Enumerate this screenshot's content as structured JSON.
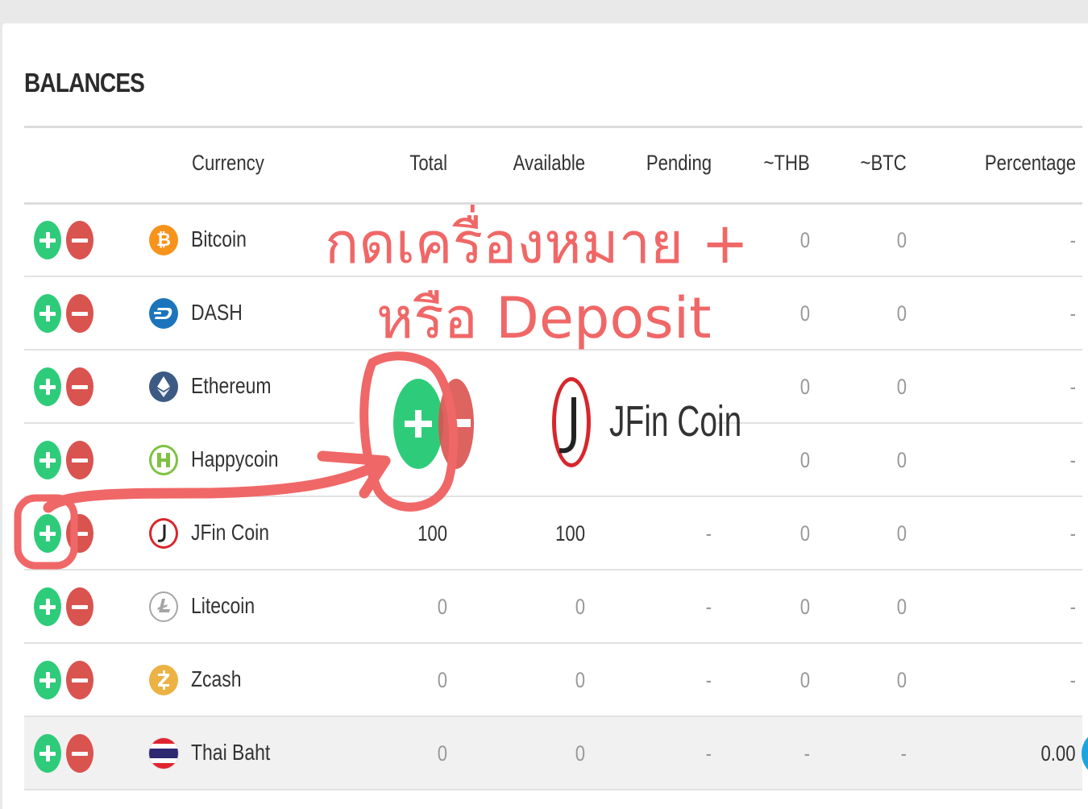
{
  "title": "BALANCES",
  "columns": {
    "currency": "Currency",
    "total": "Total",
    "available": "Available",
    "pending": "Pending",
    "thb": "~THB",
    "btc": "~BTC",
    "percentage": "Percentage"
  },
  "rows": [
    {
      "name": "Bitcoin",
      "icon": "bitcoin-icon",
      "icon_color": "#f7931a",
      "total": "",
      "available": "",
      "pending": "",
      "thb": "0",
      "btc": "0",
      "percentage": "-"
    },
    {
      "name": "DASH",
      "icon": "dash-icon",
      "icon_color": "#1c75bc",
      "total": "",
      "available": "",
      "pending": "",
      "thb": "0",
      "btc": "0",
      "percentage": "-"
    },
    {
      "name": "Ethereum",
      "icon": "ethereum-icon",
      "icon_color": "#3c5a84",
      "total": "",
      "available": "",
      "pending": "",
      "thb": "0",
      "btc": "0",
      "percentage": "-"
    },
    {
      "name": "Happycoin",
      "icon": "happycoin-icon",
      "icon_color": "#7dc242",
      "total": "",
      "available": "",
      "pending": "",
      "thb": "0",
      "btc": "0",
      "percentage": "-"
    },
    {
      "name": "JFin Coin",
      "icon": "jfin-coin-icon",
      "icon_color": "#d8262c",
      "total": "100",
      "available": "100",
      "pending": "-",
      "thb": "0",
      "btc": "0",
      "percentage": "-"
    },
    {
      "name": "Litecoin",
      "icon": "litecoin-icon",
      "icon_color": "#a5a5a5",
      "total": "0",
      "available": "0",
      "pending": "-",
      "thb": "0",
      "btc": "0",
      "percentage": "-"
    },
    {
      "name": "Zcash",
      "icon": "zcash-icon",
      "icon_color": "#ecb244",
      "total": "0",
      "available": "0",
      "pending": "-",
      "thb": "0",
      "btc": "0",
      "percentage": "-"
    },
    {
      "name": "Thai Baht",
      "icon": "thai-flag-icon",
      "icon_color": "#2d2a72",
      "total": "0",
      "available": "0",
      "pending": "-",
      "thb": "-",
      "btc": "-",
      "percentage": "0.00"
    }
  ],
  "annotation": {
    "line1": "กดเครื่องหมาย +",
    "line2": "หรือ Deposit",
    "zoom_label": "JFin Coin",
    "color": "#f06767"
  },
  "colors": {
    "plus": "#2ecc7a",
    "minus": "#d9534f"
  }
}
